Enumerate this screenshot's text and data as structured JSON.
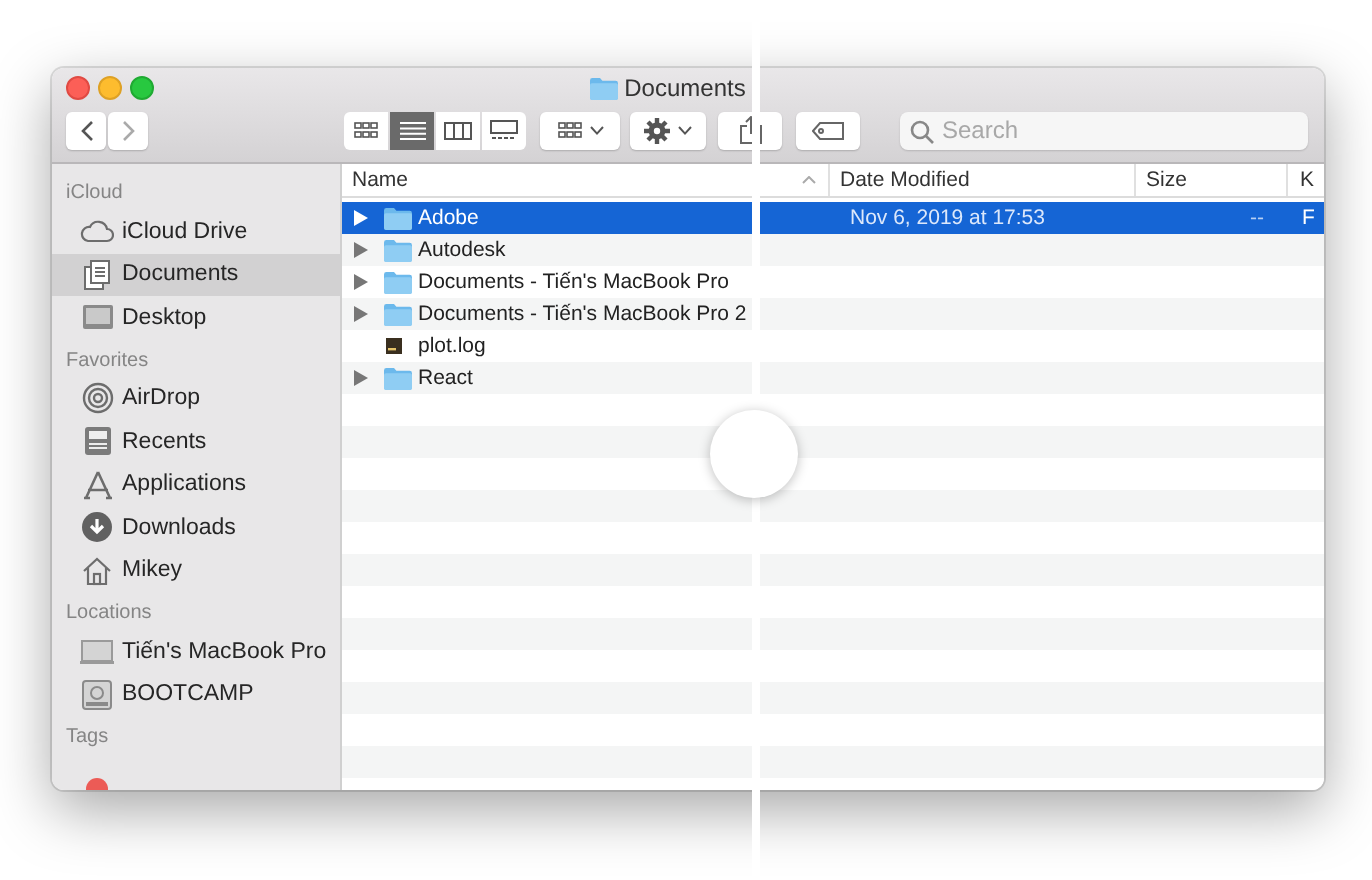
{
  "window": {
    "title": "Documents"
  },
  "toolbar": {
    "view_modes": [
      {
        "kind": "icons",
        "selected": false
      },
      {
        "kind": "list",
        "selected": true
      },
      {
        "kind": "columns",
        "selected": false
      },
      {
        "kind": "gallery",
        "selected": false
      }
    ],
    "search": {
      "placeholder": "Search"
    }
  },
  "sidebar": {
    "sections": [
      {
        "heading": "iCloud",
        "items": [
          {
            "kind": "cloud",
            "label": "iCloud Drive",
            "selected": false
          },
          {
            "kind": "documents",
            "label": "Documents",
            "selected": true
          },
          {
            "kind": "desktop",
            "label": "Desktop",
            "selected": false
          }
        ]
      },
      {
        "heading": "Favorites",
        "items": [
          {
            "kind": "airdrop",
            "label": "AirDrop",
            "selected": false
          },
          {
            "kind": "recents",
            "label": "Recents",
            "selected": false
          },
          {
            "kind": "applications",
            "label": "Applications",
            "selected": false
          },
          {
            "kind": "downloads",
            "label": "Downloads",
            "selected": false
          },
          {
            "kind": "home",
            "label": "Mikey",
            "selected": false
          }
        ]
      },
      {
        "heading": "Locations",
        "items": [
          {
            "kind": "laptop",
            "label": "Tiến's MacBook Pro",
            "selected": false
          },
          {
            "kind": "disk",
            "label": "BOOTCAMP",
            "selected": false
          }
        ]
      },
      {
        "heading": "Tags",
        "items": [
          {
            "kind": "tag",
            "color": "#ec5b56",
            "selected": false
          }
        ]
      }
    ]
  },
  "table": {
    "columns": [
      "Name",
      "Date Modified",
      "Size",
      "K"
    ],
    "rows": [
      {
        "kind": "folder",
        "name": "Adobe",
        "expanded": false,
        "selected": true,
        "date": "Nov 6, 2019 at 17:53",
        "size": "--",
        "column_4": "F"
      },
      {
        "kind": "folder",
        "name": "Autodesk",
        "expanded": false,
        "selected": false
      },
      {
        "kind": "folder",
        "name": "Documents - Tiến's MacBook Pro",
        "expanded": false,
        "selected": false
      },
      {
        "kind": "folder",
        "name": "Documents - Tiến's MacBook Pro 2",
        "expanded": false,
        "selected": false
      },
      {
        "kind": "file",
        "name": "plot.log",
        "selected": false
      },
      {
        "kind": "folder",
        "name": "React",
        "expanded": false,
        "selected": false
      }
    ]
  }
}
